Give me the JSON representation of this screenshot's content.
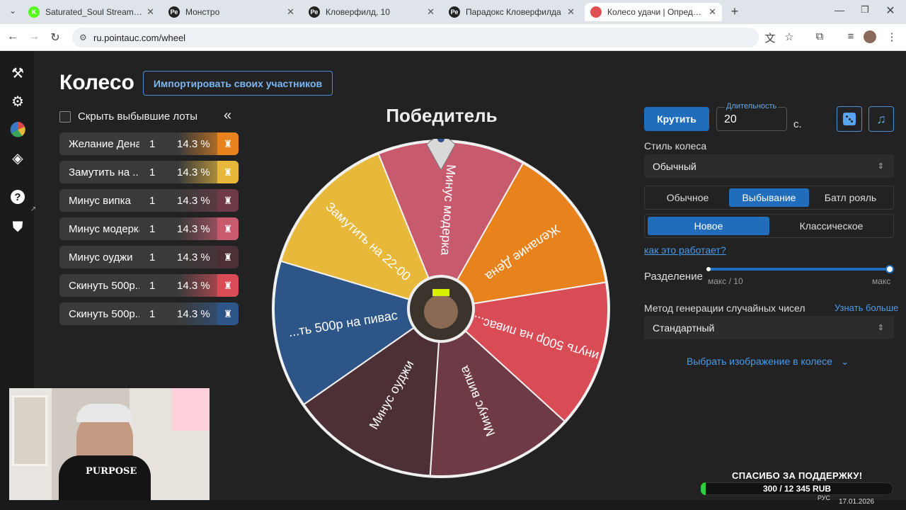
{
  "browser": {
    "tabs": [
      {
        "title": "Saturated_Soul Stream - Watch",
        "favicon": "K",
        "color": "#53fc18"
      },
      {
        "title": "Монстро",
        "favicon": "Ре",
        "color": "#222222"
      },
      {
        "title": "Кловерфилд, 10",
        "favicon": "Ре",
        "color": "#222222"
      },
      {
        "title": "Парадокс Кловерфилда",
        "favicon": "Ре",
        "color": "#222222"
      },
      {
        "title": "Колесо удачи | Определите по",
        "favicon": "wheel",
        "color": "#e05050"
      }
    ],
    "url": "ru.pointauc.com/wheel"
  },
  "page": {
    "title": "Колесо",
    "import_label": "Импортировать своих участников",
    "hide_label": "Скрыть выбывшие лоты",
    "winner_label": "Победитель"
  },
  "lots": [
    {
      "name": "Желание Дена",
      "amount": "1",
      "percent": "14.3 %",
      "color": "#e8821c"
    },
    {
      "name": "Замутить на ...",
      "amount": "1",
      "percent": "14.3 %",
      "color": "#e8b83a"
    },
    {
      "name": "Минус випка",
      "amount": "1",
      "percent": "14.3 %",
      "color": "#6e3a45"
    },
    {
      "name": "Минус модерка",
      "amount": "1",
      "percent": "14.3 %",
      "color": "#c85a6e"
    },
    {
      "name": "Минус оуджи",
      "amount": "1",
      "percent": "14.3 %",
      "color": "#4d3036"
    },
    {
      "name": "Скинуть 500р...",
      "amount": "1",
      "percent": "14.3 %",
      "color": "#d94b55"
    },
    {
      "name": "Скинуть 500р...",
      "amount": "1",
      "percent": "14.3 %",
      "color": "#2d5587"
    }
  ],
  "wheel_labels": [
    "Минус модерка",
    "Желание Дена",
    "инуть 500р на пивас...",
    "Минус випка",
    "Минус оуджи",
    "...ть 500р на пивас",
    "Замутить на 22-00"
  ],
  "controls": {
    "spin_label": "Крутить",
    "duration_label": "Длительность",
    "duration_value": "20",
    "duration_unit": "с.",
    "style_label": "Стиль колеса",
    "style_value": "Обычный",
    "mode_tabs": [
      "Обычное",
      "Выбывание",
      "Батл рояль"
    ],
    "mode_active": "Выбывание",
    "variant_tabs": [
      "Новое",
      "Классическое"
    ],
    "variant_active": "Новое",
    "how_link": "как это работает?",
    "split_label": "Разделение",
    "split_min_label": "макс / 10",
    "split_max_label": "макс",
    "split_level": 1.0,
    "rng_label": "Метод генерации случайных чисел",
    "rng_learn": "Узнать больше",
    "rng_value": "Стандартный",
    "choose_image": "Выбрать изображение в колесе"
  },
  "donation": {
    "title": "СПАСИБО ЗА ПОДДЕРЖКУ!",
    "progress": "300 / 12 345 RUB",
    "fraction": 0.024
  },
  "taskbar": {
    "lang": "РУС",
    "date": "17.01.2026"
  }
}
